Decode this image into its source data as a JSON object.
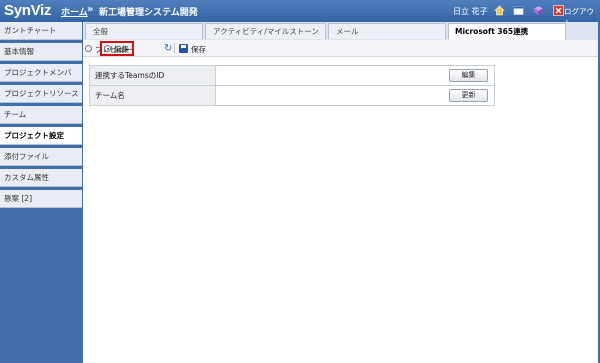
{
  "header": {
    "logo": "SynViz",
    "breadcrumb_home": "ホーム",
    "breadcrumb_sep": "»",
    "project_title": "新工場管理システム開発",
    "user_name": "日立 花子",
    "logout_label": "ログアウト"
  },
  "sidebar": {
    "items": [
      {
        "label": "ガントチャート"
      },
      {
        "label": "基本情報"
      },
      {
        "label": "プロジェクトメンバ"
      },
      {
        "label": "プロジェクトリソース"
      },
      {
        "label": "チーム"
      },
      {
        "label": "プロジェクト設定"
      },
      {
        "label": "添付ファイル"
      },
      {
        "label": "カスタム属性"
      },
      {
        "label": "懸案 [2]"
      }
    ]
  },
  "tabs": [
    {
      "label": "全般"
    },
    {
      "label": "アクティビティ/マイルストーン"
    },
    {
      "label": "メール"
    },
    {
      "label": "Microsoft 365連携"
    }
  ],
  "toolbar": {
    "preview_label": "プレビュー",
    "edit_label": "編集",
    "save_label": "保存"
  },
  "form": {
    "rows": [
      {
        "label": "連携するTeamsのID",
        "button": "編集"
      },
      {
        "label": "チーム名",
        "button": "更新"
      }
    ]
  }
}
